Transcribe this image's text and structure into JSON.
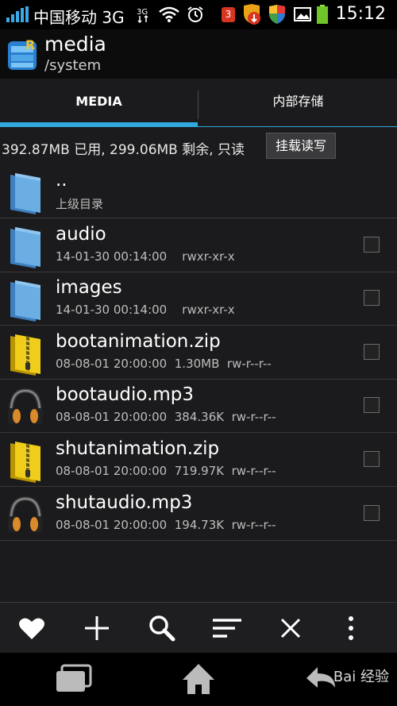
{
  "status_bar": {
    "carrier": "中国移动 3G",
    "notification_count": "3",
    "time": "15:12"
  },
  "header": {
    "title": "media",
    "path": "/system"
  },
  "tabs": [
    {
      "label": "MEDIA",
      "active": true
    },
    {
      "label": "内部存储",
      "active": false
    }
  ],
  "storage_info": {
    "text": "392.87MB 已用, 299.06MB 剩余, 只读",
    "mount_button": "挂载读写"
  },
  "files": [
    {
      "name": "..",
      "meta": "上级目录",
      "type": "folder",
      "checkbox": false
    },
    {
      "name": "audio",
      "meta": "14-01-30 00:14:00    rwxr-xr-x",
      "type": "folder",
      "checkbox": true
    },
    {
      "name": "images",
      "meta": "14-01-30 00:14:00    rwxr-xr-x",
      "type": "folder",
      "checkbox": true
    },
    {
      "name": "bootanimation.zip",
      "meta": "08-08-01 20:00:00  1.30MB  rw-r--r--",
      "type": "zip",
      "checkbox": true
    },
    {
      "name": "bootaudio.mp3",
      "meta": "08-08-01 20:00:00  384.36K  rw-r--r--",
      "type": "audio",
      "checkbox": true
    },
    {
      "name": "shutanimation.zip",
      "meta": "08-08-01 20:00:00  719.97K  rw-r--r--",
      "type": "zip",
      "checkbox": true
    },
    {
      "name": "shutaudio.mp3",
      "meta": "08-08-01 20:00:00  194.73K  rw-r--r--",
      "type": "audio",
      "checkbox": true
    }
  ],
  "toolbar": {
    "icons": [
      "heart-icon",
      "plus-icon",
      "search-icon",
      "sort-icon",
      "close-icon",
      "more-icon"
    ]
  },
  "watermark": "Bai 经验",
  "colors": {
    "accent": "#32a8e0",
    "background": "#1b1b1d",
    "folder": "#5a9ed6",
    "zip": "#e9c400"
  }
}
